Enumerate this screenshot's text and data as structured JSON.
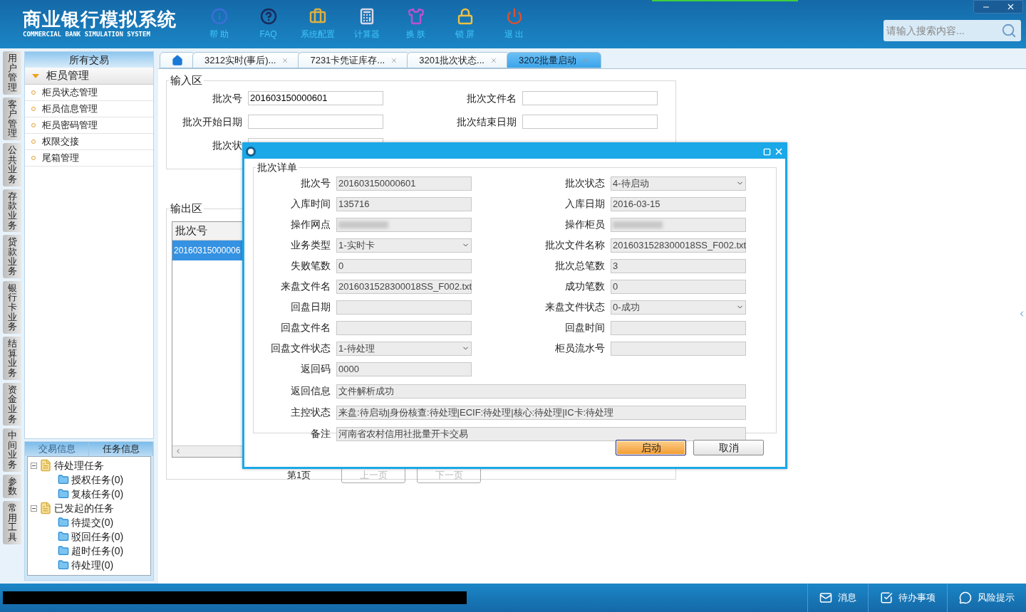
{
  "header": {
    "title": "商业银行模拟系统",
    "subtitle": "COMMERCIAL BANK SIMULATION SYSTEM",
    "tools": [
      {
        "kind": "help",
        "label": "帮 助"
      },
      {
        "kind": "faq",
        "label": "FAQ"
      },
      {
        "kind": "config",
        "label": "系统配置"
      },
      {
        "kind": "calculator",
        "label": "计算器"
      },
      {
        "kind": "skin",
        "label": "换 肤"
      },
      {
        "kind": "lock",
        "label": "锁 屏"
      },
      {
        "kind": "exit",
        "label": "退 出"
      }
    ],
    "search": {
      "placeholder": "请输入搜索内容..."
    }
  },
  "side_tabs": [
    "用户管理",
    "客户管理",
    "公共业务",
    "存款业务",
    "贷款业务",
    "银行卡业务",
    "结算业务",
    "资金业务",
    "中间业务",
    "参数",
    "常用工具"
  ],
  "menu": {
    "title": "所有交易",
    "group": {
      "label": "柜员管理",
      "expanded": true
    },
    "items": [
      "柜员状态管理",
      "柜员信息管理",
      "柜员密码管理",
      "权限交接",
      "尾箱管理"
    ]
  },
  "info_tabs": [
    {
      "label": "交易信息",
      "selected": false
    },
    {
      "label": "任务信息",
      "selected": true
    }
  ],
  "task_tree": [
    {
      "label": "待处理任务",
      "expanded": true,
      "children": [
        {
          "label": "授权任务(0)"
        },
        {
          "label": "复核任务(0)"
        }
      ]
    },
    {
      "label": "已发起的任务",
      "expanded": true,
      "children": [
        {
          "label": "待提交(0)"
        },
        {
          "label": "驳回任务(0)"
        },
        {
          "label": "超时任务(0)"
        },
        {
          "label": "待处理(0)"
        }
      ]
    }
  ],
  "tabs": [
    {
      "kind": "home",
      "selected": false
    },
    {
      "label": "3212实时(事后)...",
      "selected": false
    },
    {
      "label": "7231卡凭证库存...",
      "selected": false
    },
    {
      "label": "3201批次状态...",
      "selected": false
    },
    {
      "label": "3202批量启动",
      "selected": true
    }
  ],
  "input_area": {
    "title": "输入区",
    "fields": [
      {
        "label": "批次号",
        "value": "201603150000601"
      },
      {
        "label": "批次文件名"
      },
      {
        "label": "批次开始日期"
      },
      {
        "label": "批次结束日期"
      },
      {
        "label": "批次状"
      }
    ]
  },
  "output_area": {
    "title": "输出区",
    "column_1": "批次号",
    "rows": [
      {
        "cell": "20160315000006",
        "selected": true
      }
    ],
    "page": "第1页",
    "prev": "上一页",
    "next": "下一页"
  },
  "dialog": {
    "section": "批次详单",
    "rows": [
      {
        "left": {
          "label": "批次号",
          "kind": "text",
          "value": "201603150000601"
        },
        "right": {
          "label": "批次状态",
          "kind": "select",
          "value": "4-待启动"
        }
      },
      {
        "left": {
          "label": "入库时间",
          "kind": "text",
          "value": "135716"
        },
        "right": {
          "label": "入库日期",
          "kind": "text",
          "value": "2016-03-15"
        }
      },
      {
        "left": {
          "label": "操作网点",
          "kind": "blurred"
        },
        "right": {
          "label": "操作柜员",
          "kind": "blurred"
        }
      },
      {
        "left": {
          "label": "业务类型",
          "kind": "select",
          "value": "1-实时卡"
        },
        "right": {
          "label": "批次文件名称",
          "kind": "text",
          "value": "2016031528300018SS_F002.txt"
        }
      },
      {
        "left": {
          "label": "失败笔数",
          "kind": "text",
          "value": "0"
        },
        "right": {
          "label": "批次总笔数",
          "kind": "text",
          "value": "3"
        }
      },
      {
        "left": {
          "label": "来盘文件名",
          "kind": "text",
          "value": "2016031528300018SS_F002.txt"
        },
        "right": {
          "label": "成功笔数",
          "kind": "text",
          "value": "0"
        }
      },
      {
        "left": {
          "label": "回盘日期",
          "kind": "text"
        },
        "right": {
          "label": "来盘文件状态",
          "kind": "select",
          "value": "0-成功"
        }
      },
      {
        "left": {
          "label": "回盘文件名",
          "kind": "text"
        },
        "right": {
          "label": "回盘时间",
          "kind": "text"
        }
      },
      {
        "left": {
          "label": "回盘文件状态",
          "kind": "select",
          "value": "1-待处理"
        },
        "right": {
          "label": "柜员流水号",
          "kind": "text"
        }
      },
      {
        "left": {
          "label": "返回码",
          "kind": "text",
          "value": "0000"
        }
      }
    ],
    "wide_rows": [
      {
        "label": "返回信息",
        "value": "文件解析成功"
      },
      {
        "label": "主控状态",
        "value": "来盘:待启动|身份核查:待处理|ECIF:待处理|核心:待处理|IC卡:待处理"
      },
      {
        "label": "备注",
        "value": "河南省农村信用社批量开卡交易"
      }
    ],
    "buttons": [
      {
        "label": "启动",
        "focused": true
      },
      {
        "label": "取消",
        "focused": false
      }
    ]
  },
  "status_bar": [
    {
      "kind": "message",
      "label": "消息"
    },
    {
      "kind": "todo",
      "label": "待办事项"
    },
    {
      "kind": "risk",
      "label": "风险提示"
    }
  ]
}
